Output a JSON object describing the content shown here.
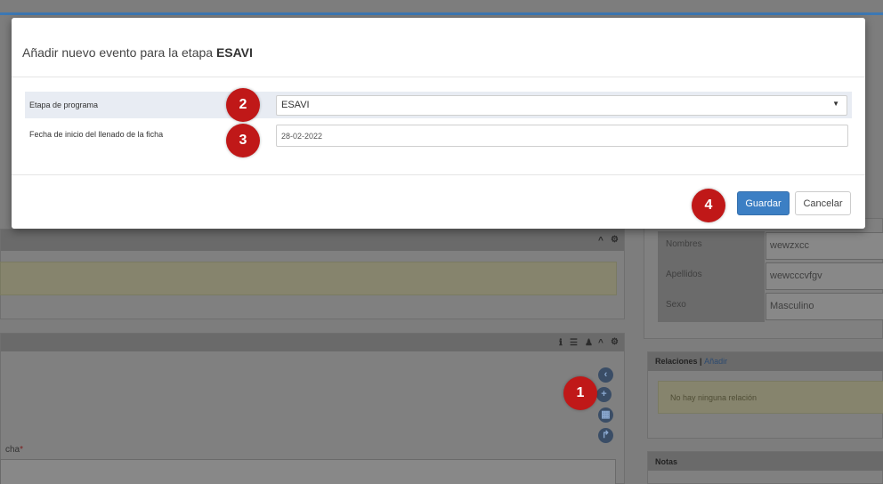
{
  "modal": {
    "title_prefix": "Añadir nuevo evento para la etapa",
    "title_stage": "ESAVI",
    "fields": {
      "stage_label": "Etapa de programa",
      "stage_value": "ESAVI",
      "date_label": "Fecha de inicio del llenado de la ficha",
      "date_value": "28-02-2022"
    },
    "save_label": "Guardar",
    "cancel_label": "Cancelar"
  },
  "markers": [
    "1",
    "2",
    "3",
    "4"
  ],
  "background": {
    "person": {
      "nombres_label": "Nombres",
      "nombres_value": "wewzxcc",
      "apellidos_label": "Apellidos",
      "apellidos_value": "wewcccvfgv",
      "sexo_label": "Sexo",
      "sexo_value": "Masculino"
    },
    "relations": {
      "title": "Relaciones",
      "separator": "|",
      "add_link": "Añadir",
      "empty_text": "No hay ninguna relación"
    },
    "notes_title": "Notas",
    "partial_label": "cha",
    "required_mark": "*"
  },
  "colors": {
    "primary": "#3c7fc4",
    "marker": "#c01818",
    "brand_stripe": "#3c78b4"
  }
}
